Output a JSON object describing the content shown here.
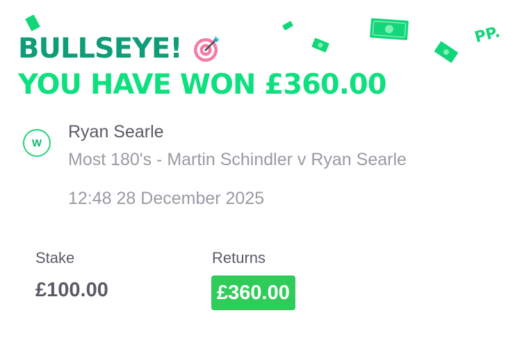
{
  "header": {
    "line1": "BULLSEYE!",
    "line2": "YOU HAVE WON £360.00",
    "brand": "PP.",
    "icon": "target-icon"
  },
  "bet": {
    "status_badge": "W",
    "selection": "Ryan Searle",
    "market": "Most 180's - Martin Schindler v Ryan Searle",
    "datetime": "12:48 28 December 2025"
  },
  "summary": {
    "stake_label": "Stake",
    "stake_value": "£100.00",
    "returns_label": "Returns",
    "returns_value": "£360.00"
  },
  "colors": {
    "headline_dark": "#0f9d77",
    "headline_bright": "#0ee080",
    "returns_badge": "#2fcc5a",
    "banknote": "#12d679"
  }
}
